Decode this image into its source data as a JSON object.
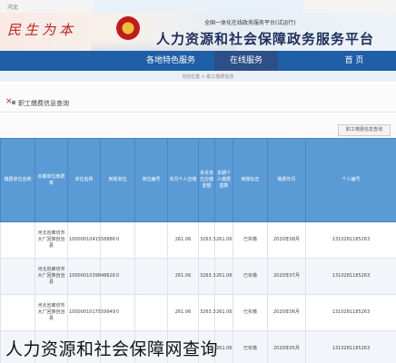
{
  "topbar": {
    "location": "河北"
  },
  "banner": {
    "brand": "民生为本",
    "subtitle": "全国一体化在线政务服务平台(试运行)",
    "title": "人力资源和社会保障政务服务平台",
    "colors": {
      "brand": "#c0211b",
      "title": "#1e2f5c"
    }
  },
  "nav": {
    "items": [
      {
        "label": "首 页",
        "active": false
      },
      {
        "label": "在线服务",
        "active": true
      },
      {
        "label": "各地特色服务",
        "active": false
      }
    ],
    "accent": "#1f5fa8"
  },
  "breadcrumb": "当前位置 > 职工缴费信息",
  "panel": {
    "title": "职工缴费信息查询",
    "button": "职工缴费信息查询"
  },
  "table": {
    "columns": [
      "个人编号",
      "缴费年月",
      "到账标志",
      "本期个人缴费基数",
      "本月单位应缴金额",
      "本月个人应缴",
      "单位编号",
      "到账单位",
      "单位名称",
      "本期单位缴费率",
      "缴费单位名称"
    ],
    "rows": [
      [
        "1310281185263",
        "2020年08月",
        "已实缴",
        "261.06",
        "3263.3",
        "261.06",
        "",
        "0",
        "1000001041558886",
        "河北省廊坊市大厂回族自治县",
        ""
      ],
      [
        "1310281185263",
        "2020年07月",
        "已实缴",
        "261.06",
        "3263.3",
        "261.06",
        "",
        "0",
        "1000001039848626",
        "河北省廊坊市大厂回族自治县",
        ""
      ],
      [
        "1310281185263",
        "2020年06月",
        "已实缴",
        "261.06",
        "3263.3",
        "261.06",
        "",
        "0",
        "1000001017559949",
        "河北省廊坊市大厂回族自治县",
        ""
      ],
      [
        "1310281185263",
        "2020年05月",
        "已实缴",
        "261.06",
        "",
        "",
        "",
        "",
        "",
        "",
        ""
      ]
    ]
  },
  "caption": "人力资源和社会保障网查询"
}
